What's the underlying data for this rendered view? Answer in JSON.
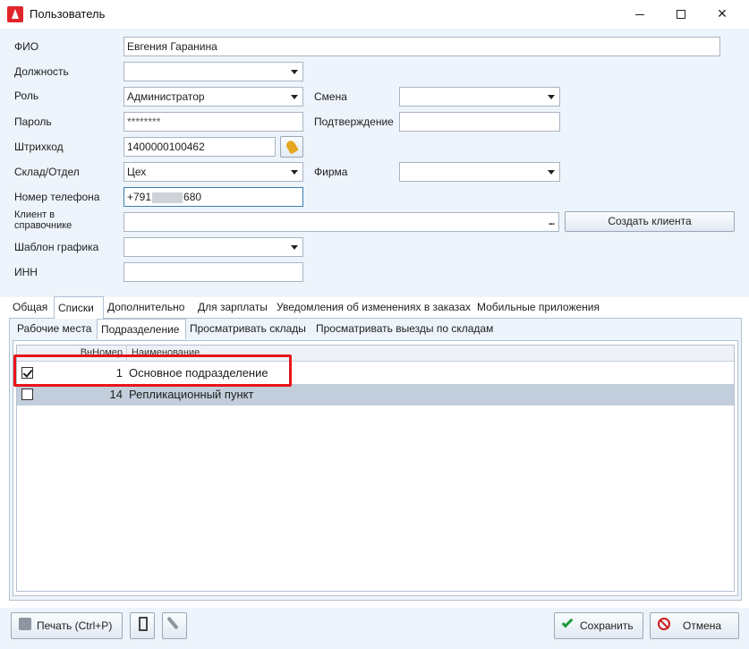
{
  "window": {
    "title": "Пользователь",
    "min_icon": "minimize-icon",
    "max_icon": "maximize-icon",
    "close_icon": "close-icon",
    "close_glyph": "✕"
  },
  "form": {
    "fio": {
      "label": "ФИО",
      "value": "Евгения Гаранина"
    },
    "position": {
      "label": "Должность",
      "value": ""
    },
    "role": {
      "label": "Роль",
      "value": "Администратор"
    },
    "shift": {
      "label": "Смена",
      "value": ""
    },
    "password": {
      "label": "Пароль",
      "value": "********"
    },
    "confirm": {
      "label": "Подтверждение",
      "value": ""
    },
    "barcode": {
      "label": "Штрихкод",
      "value": "1400000100462"
    },
    "warehouse": {
      "label": "Склад/Отдел",
      "value": "Цех"
    },
    "company": {
      "label": "Фирма",
      "value": ""
    },
    "phone": {
      "label": "Номер телефона",
      "value_start": "+791",
      "value_end": "680"
    },
    "client": {
      "label": "Клиент в справочнике",
      "value": "",
      "ellipsis": "..."
    },
    "create_client": "Создать клиента",
    "schedule": {
      "label": "Шаблон графика",
      "value": ""
    },
    "inn": {
      "label": "ИНН",
      "value": ""
    }
  },
  "tabs": [
    "Общая",
    "Списки",
    "Дополнительно",
    "Для зарплаты",
    "Уведомления об изменениях в заказах",
    "Мобильные приложения"
  ],
  "active_tab": "Списки",
  "subtabs": [
    "Рабочие места",
    "Подразделение",
    "Просматривать склады",
    "Просматривать выезды по складам"
  ],
  "active_subtab": "Подразделение",
  "grid": {
    "columns": [
      "ВнНомер",
      "Наименование"
    ],
    "rows": [
      {
        "checked": true,
        "num": "1",
        "name": "Основное подразделение"
      },
      {
        "checked": false,
        "num": "14",
        "name": "Репликационный пункт"
      }
    ]
  },
  "footer": {
    "print": "Печать (Ctrl+P)",
    "save": "Сохранить",
    "cancel": "Отмена"
  },
  "colors": {
    "highlight": "#e8141b",
    "brand": "#e1262b",
    "form_bg": "#eef4fb",
    "selected_row": "#c2cedb"
  }
}
